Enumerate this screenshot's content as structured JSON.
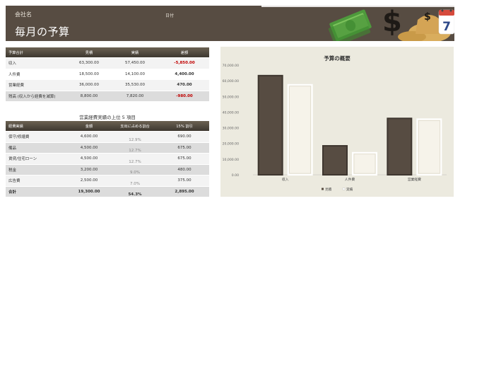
{
  "header": {
    "company": "会社名",
    "date_label": "日付",
    "title": "毎月の予算",
    "calendar_day": "7"
  },
  "budget_table": {
    "columns": [
      "予算合計",
      "見積",
      "実績",
      "差額"
    ],
    "rows": [
      {
        "label": "収入",
        "estimate": "63,300.00",
        "actual": "57,450.00",
        "diff": "-5,850.00"
      },
      {
        "label": "人件費",
        "estimate": "18,500.00",
        "actual": "14,100.00",
        "diff": "4,400.00"
      },
      {
        "label": "営業経費",
        "estimate": "36,000.00",
        "actual": "35,530.00",
        "diff": "470.00"
      },
      {
        "label": "残高 (収入から経費を減算)",
        "estimate": "8,800.00",
        "actual": "7,820.00",
        "diff": "-980.00"
      }
    ]
  },
  "expense_section": {
    "title": "営業経費実績の上位 5 項目",
    "columns": [
      "経費実績",
      "金額",
      "支出に占める割合",
      "15% 割引"
    ],
    "rows": [
      {
        "label": "保守/修繕費",
        "amount": "4,600.00",
        "pct": "12.9%",
        "discount": "690.00"
      },
      {
        "label": "備品",
        "amount": "4,500.00",
        "pct": "12.7%",
        "discount": "675.00"
      },
      {
        "label": "賃貸/住宅ローン",
        "amount": "4,500.00",
        "pct": "12.7%",
        "discount": "675.00"
      },
      {
        "label": "税金",
        "amount": "3,200.00",
        "pct": "9.0%",
        "discount": "480.00"
      },
      {
        "label": "広告費",
        "amount": "2,500.00",
        "pct": "7.0%",
        "discount": "375.00"
      }
    ],
    "total": {
      "label": "合計",
      "amount": "19,300.00",
      "pct": "54.3%",
      "discount": "2,895.00"
    }
  },
  "chart_data": {
    "type": "bar",
    "title": "予算の概要",
    "categories": [
      "収入",
      "人件費",
      "営業経費"
    ],
    "series": [
      {
        "name": "見積",
        "values": [
          63300,
          18500,
          36000
        ]
      },
      {
        "name": "実績",
        "values": [
          57450,
          14100,
          35530
        ]
      }
    ],
    "ylim": [
      0,
      70000
    ],
    "yticks": [
      "0.00",
      "10,000.00",
      "20,000.00",
      "30,000.00",
      "40,000.00",
      "50,000.00",
      "60,000.00",
      "70,000.00"
    ],
    "legend": "bottom",
    "colors": {
      "estimate": "#574c42",
      "actual": "#f6f3ea"
    }
  },
  "colors": {
    "header_bg": "#574c42",
    "negative": "#c00000",
    "chart_bg": "#eceadf"
  }
}
